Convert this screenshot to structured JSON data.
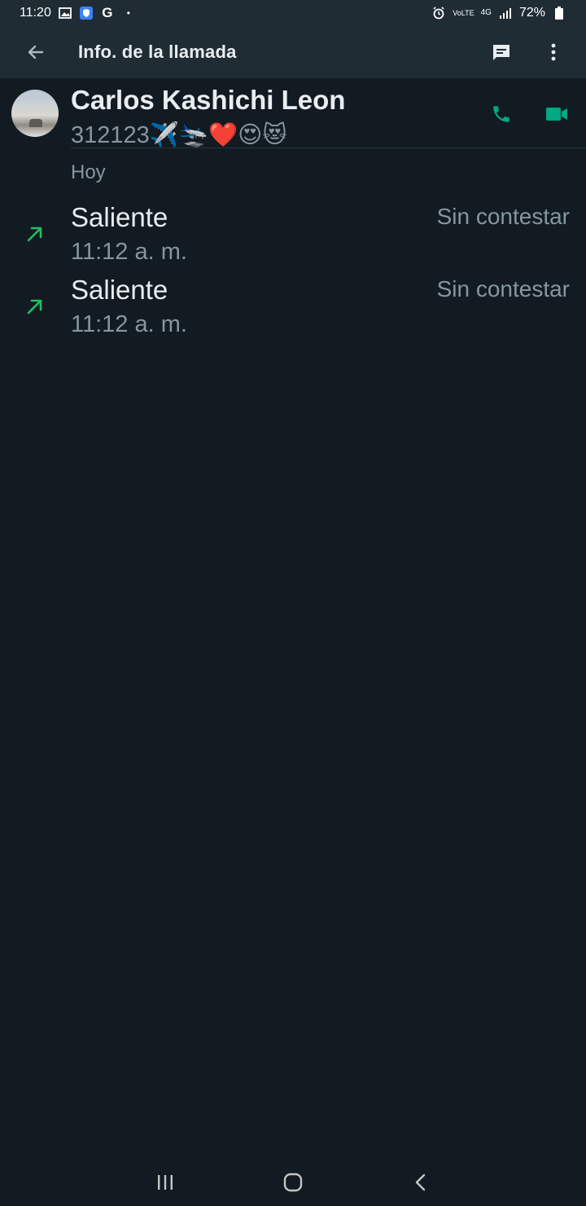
{
  "status_bar": {
    "time": "11:20",
    "left_icons": [
      "gallery-icon",
      "shield-icon",
      "google-icon",
      "dot-icon"
    ],
    "right_icons": [
      "alarm-icon",
      "volte-icon",
      "4g-icon",
      "signal-icon",
      "battery-icon"
    ],
    "volte_label": "VoLTE",
    "network_label": "4G",
    "battery_percent": "72%"
  },
  "app_bar": {
    "title": "Info. de la llamada",
    "back_icon": "arrow-back-icon",
    "message_icon": "message-icon",
    "more_icon": "more-vert-icon"
  },
  "contact": {
    "name": "Carlos Kashichi Leon",
    "number": "312123✈️🛬❤️😍😻",
    "actions": [
      "voice-call-icon",
      "video-call-icon"
    ]
  },
  "call_log": {
    "date_label": "Hoy",
    "entries": [
      {
        "type": "Saliente",
        "time": "11:12 a. m.",
        "status": "Sin contestar"
      },
      {
        "type": "Saliente",
        "time": "11:12 a. m.",
        "status": "Sin contestar"
      }
    ]
  },
  "colors": {
    "background": "#121b22",
    "app_bar": "#1f2c34",
    "accent_green": "#00a884",
    "arrow_green": "#21c063",
    "primary_text": "#e9edef",
    "secondary_text": "#8696a0"
  },
  "nav_bar": {
    "buttons": [
      "recent-apps-icon",
      "home-icon",
      "back-icon"
    ]
  }
}
